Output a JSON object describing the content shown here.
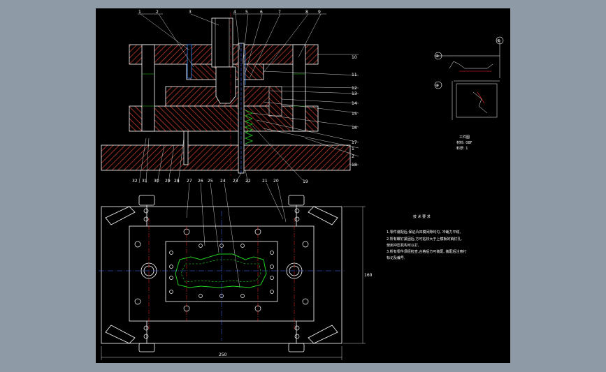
{
  "section_labels_top": [
    "1",
    "2",
    "3",
    "4",
    "5",
    "6",
    "7",
    "8",
    "9"
  ],
  "section_labels_right": [
    "10",
    "11",
    "12",
    "13",
    "14",
    "15",
    "16",
    "17",
    "1",
    "2",
    "18"
  ],
  "section_label_bottom": "19",
  "plan_labels": [
    "32",
    "31",
    "30",
    "29",
    "28",
    "27",
    "26",
    "25",
    "24",
    "23",
    "22",
    "21",
    "20"
  ],
  "detail_symbols": [
    "⊕",
    "⊕",
    "⊕"
  ],
  "detail_caption": {
    "line1": "工件图",
    "line2": "材料: 08F",
    "line3": "料厚: 1"
  },
  "tech_notes": {
    "title": "技 术 要 求",
    "lines": [
      "1.零件装配后,保证凸凹模间隙均匀,    冲裁力平稳,",
      "2.所有螺钉紧固后,方可钻铰大于上模板的销钉孔,",
      "    使用冲压机构可以打,",
      "3.所有零件须经检查,合格后方可装配,    装配后注意打",
      "    标记及编号."
    ]
  },
  "dimensions": {
    "plan_width": "250",
    "plan_height": "160"
  },
  "colors": {
    "background": "#000000",
    "outline": "#ffffff",
    "hatch": "#c0392b",
    "centerline_red": "#ff2a2a",
    "centerline_blue": "#4a6cff",
    "part_green": "#22d022",
    "accent_blue": "#3a8dff"
  }
}
